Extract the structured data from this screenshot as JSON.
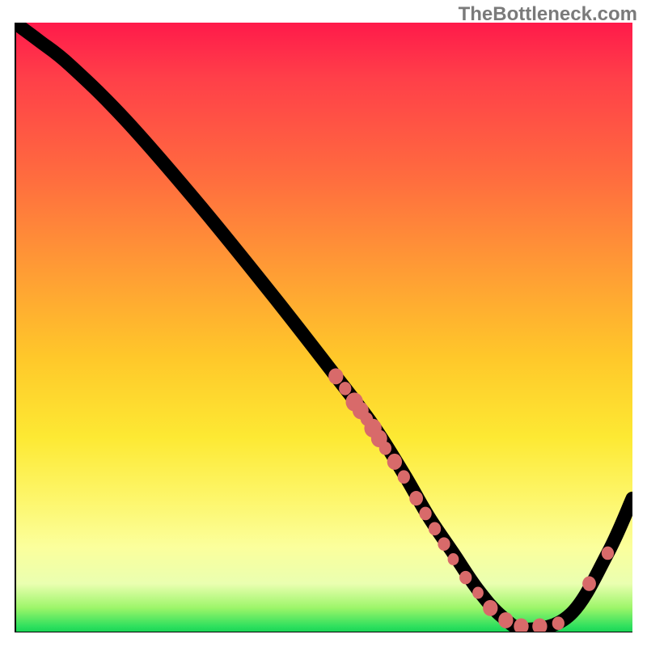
{
  "watermark": "TheBottleneck.com",
  "chart_data": {
    "type": "line",
    "title": "",
    "xlabel": "",
    "ylabel": "",
    "xlim": [
      0,
      100
    ],
    "ylim": [
      0,
      100
    ],
    "grid": false,
    "legend": false,
    "background": "rainbow-vertical-gradient",
    "gradient_stops": [
      {
        "pos": 0.0,
        "color": "#ff1a4a"
      },
      {
        "pos": 0.25,
        "color": "#ff6b3f"
      },
      {
        "pos": 0.55,
        "color": "#ffc82a"
      },
      {
        "pos": 0.8,
        "color": "#fdf66a"
      },
      {
        "pos": 0.96,
        "color": "#9cf569"
      },
      {
        "pos": 1.0,
        "color": "#17d455"
      }
    ],
    "series": [
      {
        "name": "bottleneck-curve",
        "type": "line",
        "color": "#000000",
        "x": [
          0,
          4,
          9,
          18,
          30,
          42,
          52,
          58,
          63,
          67,
          71,
          75,
          79,
          83,
          90,
          96,
          100
        ],
        "y": [
          100,
          97,
          93,
          84,
          70,
          55,
          42,
          34,
          26,
          19,
          13,
          7,
          2.5,
          0.5,
          3,
          13,
          22
        ]
      }
    ],
    "markers": [
      {
        "x": 52.0,
        "y": 42.0,
        "r": 1.2
      },
      {
        "x": 53.5,
        "y": 40.0,
        "r": 1.0
      },
      {
        "x": 55.0,
        "y": 37.8,
        "r": 1.4
      },
      {
        "x": 56.0,
        "y": 36.4,
        "r": 1.3
      },
      {
        "x": 57.0,
        "y": 35.0,
        "r": 1.0
      },
      {
        "x": 58.0,
        "y": 33.5,
        "r": 1.4
      },
      {
        "x": 59.0,
        "y": 31.8,
        "r": 1.3
      },
      {
        "x": 60.0,
        "y": 30.2,
        "r": 1.0
      },
      {
        "x": 61.5,
        "y": 28.0,
        "r": 1.2
      },
      {
        "x": 63.0,
        "y": 25.5,
        "r": 1.0
      },
      {
        "x": 65.0,
        "y": 22.0,
        "r": 1.1
      },
      {
        "x": 66.5,
        "y": 19.5,
        "r": 1.0
      },
      {
        "x": 68.0,
        "y": 17.0,
        "r": 1.0
      },
      {
        "x": 69.5,
        "y": 14.5,
        "r": 1.0
      },
      {
        "x": 71.0,
        "y": 12.0,
        "r": 0.9
      },
      {
        "x": 73.0,
        "y": 9.0,
        "r": 1.0
      },
      {
        "x": 75.0,
        "y": 6.5,
        "r": 0.9
      },
      {
        "x": 77.0,
        "y": 4.0,
        "r": 1.2
      },
      {
        "x": 79.5,
        "y": 2.0,
        "r": 1.2
      },
      {
        "x": 82.0,
        "y": 1.0,
        "r": 1.2
      },
      {
        "x": 85.0,
        "y": 1.0,
        "r": 1.2
      },
      {
        "x": 88.0,
        "y": 1.5,
        "r": 1.0
      },
      {
        "x": 93.0,
        "y": 8.0,
        "r": 1.1
      },
      {
        "x": 96.0,
        "y": 13.0,
        "r": 1.0
      }
    ]
  }
}
